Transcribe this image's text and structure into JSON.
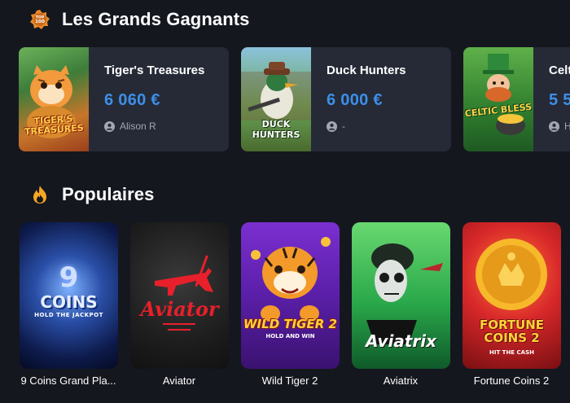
{
  "sections": {
    "winners_title": "Les Grands Gagnants",
    "winners_icon_text": "TOP 100",
    "popular_title": "Populaires"
  },
  "winners": [
    {
      "game": "Tiger's Treasures",
      "amount": "6 060 €",
      "user": "Alison R",
      "thumb_text": "TIGER'S TREASURES"
    },
    {
      "game": "Duck Hunters",
      "amount": "6 000 €",
      "user": "-",
      "thumb_text": "DUCK HUNTERS"
    },
    {
      "game": "Celt",
      "amount": "5 5",
      "user": "H",
      "thumb_text": "CELTIC BLESS"
    }
  ],
  "popular": [
    {
      "title": "9 Coins Grand Pla...",
      "logo_main": "COINS",
      "logo_sub": "HOLD THE JACKPOT",
      "badge": "9"
    },
    {
      "title": "Aviator",
      "logo_main": "Aviator"
    },
    {
      "title": "Wild Tiger 2",
      "logo_main": "WILD TIGER 2",
      "logo_sub": "HOLD AND WIN"
    },
    {
      "title": "Aviatrix",
      "logo_main": "Aviatrix"
    },
    {
      "title": "Fortune Coins 2",
      "logo_main": "FORTUNE COINS 2",
      "logo_sub": "HIT THE CASH"
    }
  ],
  "colors": {
    "background": "#15171f",
    "card": "#252a36",
    "amount": "#3d8fe8",
    "user_text": "#a2a7b4",
    "fire_icon": "#f5a623"
  }
}
